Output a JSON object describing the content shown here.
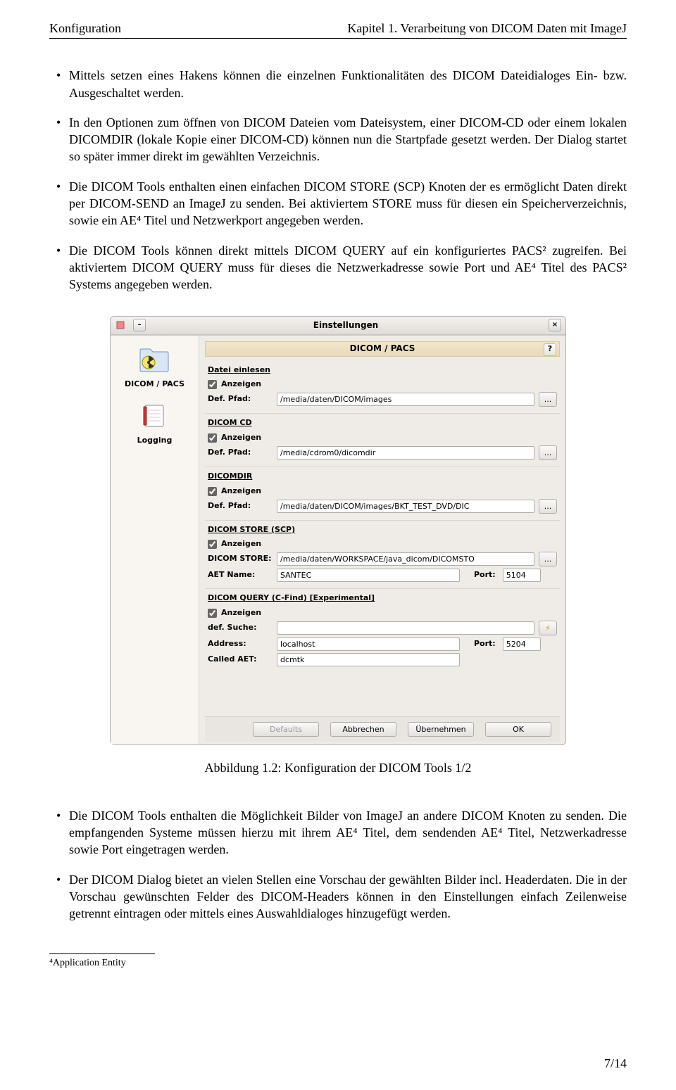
{
  "header": {
    "left": "Konfiguration",
    "right": "Kapitel 1. Verarbeitung von DICOM Daten mit ImageJ"
  },
  "bullets_top": [
    "Mittels setzen eines Hakens können die einzelnen Funktionalitäten des DICOM Dateidialoges Ein- bzw. Ausgeschaltet werden.",
    "In den Optionen zum öffnen von DICOM Dateien vom Dateisystem, einer DICOM-CD oder einem lokalen DICOMDIR (lokale Kopie einer DICOM-CD) können nun die Startpfade gesetzt werden. Der Dialog startet so später immer direkt im gewählten Verzeichnis.",
    "Die DICOM Tools enthalten einen einfachen DICOM STORE (SCP) Knoten der es ermöglicht Daten direkt per DICOM-SEND an ImageJ zu senden. Bei aktiviertem STORE muss für diesen ein Speicherverzeichnis, sowie ein AE⁴ Titel und Netzwerkport angegeben werden.",
    "Die DICOM Tools können direkt mittels DICOM QUERY auf ein konfiguriertes PACS² zugreifen. Bei aktiviertem DICOM QUERY muss für dieses die Netzwerkadresse sowie Port und AE⁴ Titel des PACS² Systems angegeben werden."
  ],
  "figure_caption": "Abbildung 1.2: Konfiguration der DICOM Tools 1/2",
  "bullets_bottom": [
    "Die DICOM Tools enthalten die Möglichkeit Bilder von ImageJ an andere DICOM Knoten zu senden. Die empfangenden Systeme müssen hierzu mit ihrem AE⁴ Titel, dem sendenden AE⁴ Titel, Netzwerkadresse sowie Port eingetragen werden.",
    "Der DICOM Dialog bietet an vielen Stellen eine Vorschau der gewählten Bilder incl. Headerdaten. Die in der Vorschau gewünschten Felder des DICOM-Headers können in den Einstellungen einfach Zeilenweise getrennt eintragen oder mittels eines Auswahldialoges hinzugefügt werden."
  ],
  "footnote": "⁴Application Entity",
  "page_num": "7/14",
  "prefs": {
    "title": "Einstellungen",
    "headerbar": "DICOM / PACS",
    "help": "?",
    "side": {
      "item1": "DICOM / PACS",
      "item2": "Logging"
    },
    "groups": {
      "g1": {
        "title": "Datei einlesen",
        "show": "Anzeigen",
        "path_lbl": "Def. Pfad:",
        "path": "/media/daten/DICOM/images",
        "dots": "..."
      },
      "g2": {
        "title": "DICOM CD",
        "show": "Anzeigen",
        "path_lbl": "Def. Pfad:",
        "path": "/media/cdrom0/dicomdir",
        "dots": "..."
      },
      "g3": {
        "title": "DICOMDIR",
        "show": "Anzeigen",
        "path_lbl": "Def. Pfad:",
        "path": "/media/daten/DICOM/images/BKT_TEST_DVD/DIC",
        "dots": "..."
      },
      "g4": {
        "title": "DICOM STORE (SCP)",
        "show": "Anzeigen",
        "store_lbl": "DICOM STORE:",
        "store": "/media/daten/WORKSPACE/java_dicom/DICOMSTO",
        "dots": "...",
        "aet_lbl": "AET Name:",
        "aet": "SANTEC",
        "port_lbl": "Port:",
        "port": "5104"
      },
      "g5": {
        "title": "DICOM QUERY (C-Find) [Experimental]",
        "show": "Anzeigen",
        "search_lbl": "def. Suche:",
        "addr_lbl": "Address:",
        "addr": "localhost",
        "port_lbl": "Port:",
        "port": "5204",
        "called_lbl": "Called AET:",
        "called": "dcmtk",
        "bolt": "⚡"
      }
    },
    "buttons": {
      "defaults": "Defaults",
      "cancel": "Abbrechen",
      "apply": "Übernehmen",
      "ok": "OK"
    }
  }
}
